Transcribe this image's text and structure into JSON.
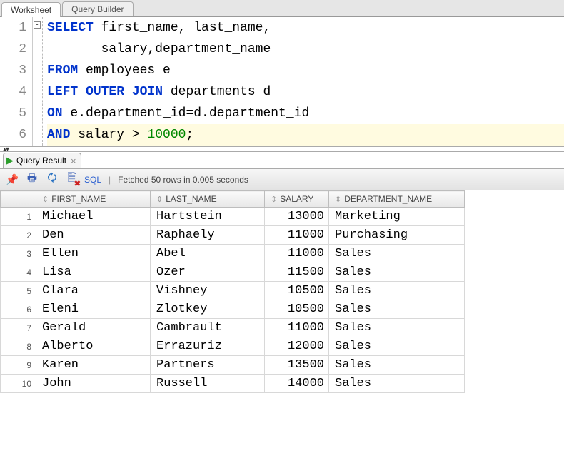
{
  "tabs": {
    "worksheet": "Worksheet",
    "querybuilder": "Query Builder"
  },
  "editor": {
    "line_numbers": [
      "1",
      "2",
      "3",
      "4",
      "5",
      "6"
    ],
    "fold_char": "-",
    "code_html": [
      "<span class='kw'>SELECT</span> first_name, last_name,",
      "       salary,department_name",
      "<span class='kw'>FROM</span> employees e",
      "<span class='kw'>LEFT</span> <span class='kw'>OUTER</span> <span class='kw'>JOIN</span> departments d",
      "<span class='kw'>ON</span> e.department_id=d.department_id",
      "<span class='kw'>AND</span> salary > <span class='num'>10000</span>;"
    ],
    "highlight_line_index": 5
  },
  "result_tab": {
    "label": "Query Result",
    "close": "×",
    "play": "▶"
  },
  "toolbar": {
    "sql_link": "SQL",
    "separator": "|",
    "status": "Fetched 50 rows in 0.005 seconds"
  },
  "grid": {
    "sort_glyph": "⇕",
    "headers": [
      "FIRST_NAME",
      "LAST_NAME",
      "SALARY",
      "DEPARTMENT_NAME"
    ],
    "rows": [
      {
        "n": "1",
        "first": "Michael",
        "last": "Hartstein",
        "salary": "13000",
        "dept": "Marketing"
      },
      {
        "n": "2",
        "first": "Den",
        "last": "Raphaely",
        "salary": "11000",
        "dept": "Purchasing"
      },
      {
        "n": "3",
        "first": "Ellen",
        "last": "Abel",
        "salary": "11000",
        "dept": "Sales"
      },
      {
        "n": "4",
        "first": "Lisa",
        "last": "Ozer",
        "salary": "11500",
        "dept": "Sales"
      },
      {
        "n": "5",
        "first": "Clara",
        "last": "Vishney",
        "salary": "10500",
        "dept": "Sales"
      },
      {
        "n": "6",
        "first": "Eleni",
        "last": "Zlotkey",
        "salary": "10500",
        "dept": "Sales"
      },
      {
        "n": "7",
        "first": "Gerald",
        "last": "Cambrault",
        "salary": "11000",
        "dept": "Sales"
      },
      {
        "n": "8",
        "first": "Alberto",
        "last": "Errazuriz",
        "salary": "12000",
        "dept": "Sales"
      },
      {
        "n": "9",
        "first": "Karen",
        "last": "Partners",
        "salary": "13500",
        "dept": "Sales"
      },
      {
        "n": "10",
        "first": "John",
        "last": "Russell",
        "salary": "14000",
        "dept": "Sales"
      }
    ]
  }
}
